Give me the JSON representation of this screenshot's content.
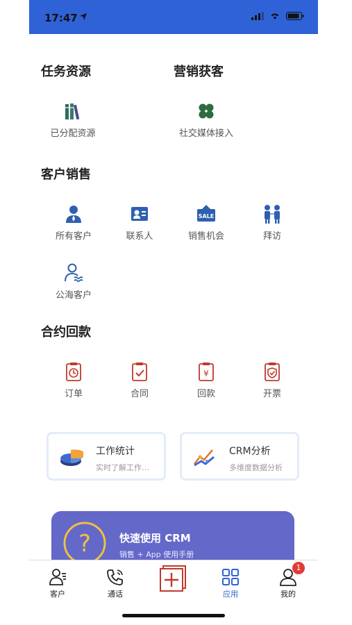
{
  "status_bar": {
    "time": "17:47"
  },
  "sections": {
    "task_resources": {
      "title": "任务资源",
      "items": [
        {
          "label": "已分配资源",
          "icon": "books-icon"
        }
      ]
    },
    "marketing": {
      "title": "营销获客",
      "items": [
        {
          "label": "社交媒体接入",
          "icon": "clover-icon"
        }
      ]
    },
    "customer_sales": {
      "title": "客户销售",
      "items": [
        {
          "label": "所有客户",
          "icon": "person-icon"
        },
        {
          "label": "联系人",
          "icon": "contact-card-icon"
        },
        {
          "label": "销售机会",
          "icon": "sale-tag-icon"
        },
        {
          "label": "拜访",
          "icon": "meeting-icon"
        },
        {
          "label": "公海客户",
          "icon": "public-customer-icon"
        }
      ]
    },
    "contract_payment": {
      "title": "合约回款",
      "items": [
        {
          "label": "订单",
          "icon": "clipboard-clock-icon"
        },
        {
          "label": "合同",
          "icon": "clipboard-check-icon"
        },
        {
          "label": "回款",
          "icon": "clipboard-yen-icon"
        },
        {
          "label": "开票",
          "icon": "clipboard-shield-icon"
        }
      ]
    }
  },
  "cards": [
    {
      "title": "工作统计",
      "subtitle": "实时了解工作…",
      "icon": "pie-chart-icon"
    },
    {
      "title": "CRM分析",
      "subtitle": "多维度数据分析",
      "icon": "analysis-chart-icon"
    }
  ],
  "banner": {
    "title": "快速使用 CRM",
    "subtitle": "销售 + App 使用手册",
    "icon": "question-icon"
  },
  "tabbar": {
    "items": [
      {
        "label": "客户"
      },
      {
        "label": "通话"
      },
      {
        "label": ""
      },
      {
        "label": "应用"
      },
      {
        "label": "我的",
        "badge": "1"
      }
    ]
  },
  "colors": {
    "primary": "#2f62d6",
    "red": "#c0392b",
    "banner": "#6468c9"
  }
}
